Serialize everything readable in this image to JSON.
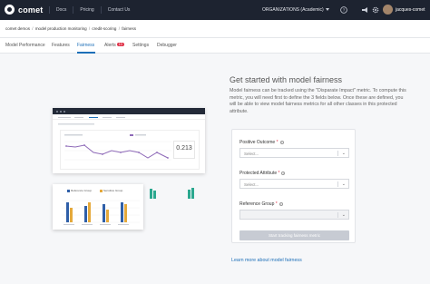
{
  "topbar": {
    "brand": "comet",
    "nav": [
      "Docs",
      "Pricing",
      "Contact Us"
    ],
    "org": "ORGANIZATIONS (Academic)",
    "icons": [
      "help-icon",
      "announcement-icon",
      "settings-icon"
    ],
    "user": "jacques-comet"
  },
  "breadcrumb": [
    "comet demos",
    "model production monitoring",
    "credit-scoring",
    "fairness"
  ],
  "tabs": [
    {
      "label": "Model Performance",
      "active": false
    },
    {
      "label": "Features",
      "active": false
    },
    {
      "label": "Fairness",
      "active": true
    },
    {
      "label": "Alerts",
      "badge": "10",
      "active": false
    },
    {
      "label": "Settings",
      "active": false
    },
    {
      "label": "Debugger",
      "active": false
    }
  ],
  "illustration": {
    "metric_value": "0.213",
    "legend": [
      "Reference Group",
      "Sensitive Group"
    ]
  },
  "panel": {
    "title": "Get started with model fairness",
    "description": "Model fairness can be tracked using the \"Disparate Impact\" metric. To compute this metric, you will need first to define the 3 fields below. Once these are defined, you will be able to view model fairness metrics for all other classes in this protected attribute.",
    "fields": [
      {
        "label": "Positive Outcome",
        "required": "*",
        "placeholder": "Select..."
      },
      {
        "label": "Protected Attribute",
        "required": "*",
        "placeholder": "Select..."
      },
      {
        "label": "Reference Group",
        "required": "*",
        "placeholder": ""
      }
    ],
    "button": "Start tracking fairness metric",
    "learn_more": "Learn more about model fairness"
  },
  "colors": {
    "accent": "#1d6fb8",
    "topbar": "#1d2330",
    "line": "#8e6ab8",
    "bar_reference": "#2f5fa8",
    "bar_sensitive": "#e5a93b",
    "teal": "#2ba88f"
  }
}
